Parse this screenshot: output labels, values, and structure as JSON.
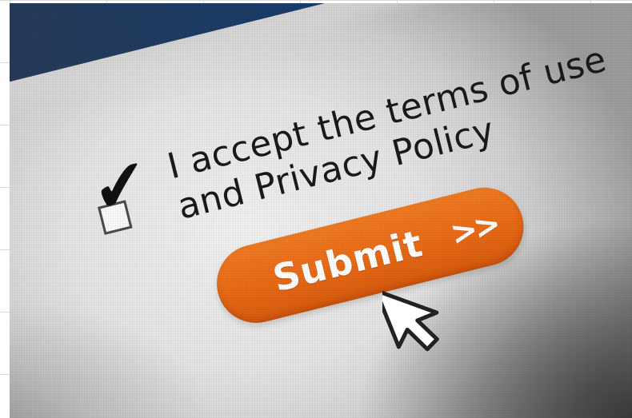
{
  "form": {
    "checkbox_checked": true,
    "checkmark_glyph": "✔",
    "terms_line1": "I accept the terms of use",
    "terms_line2": "and Privacy Policy",
    "submit_label": "Submit",
    "submit_chevron": ">>"
  },
  "icons": {
    "check": "checkmark-icon",
    "pointer": "mouse-pointer-icon"
  },
  "colors": {
    "button_orange": "#e86a16",
    "header_blue": "#163d6e",
    "text_dark": "#1a1a1a"
  }
}
